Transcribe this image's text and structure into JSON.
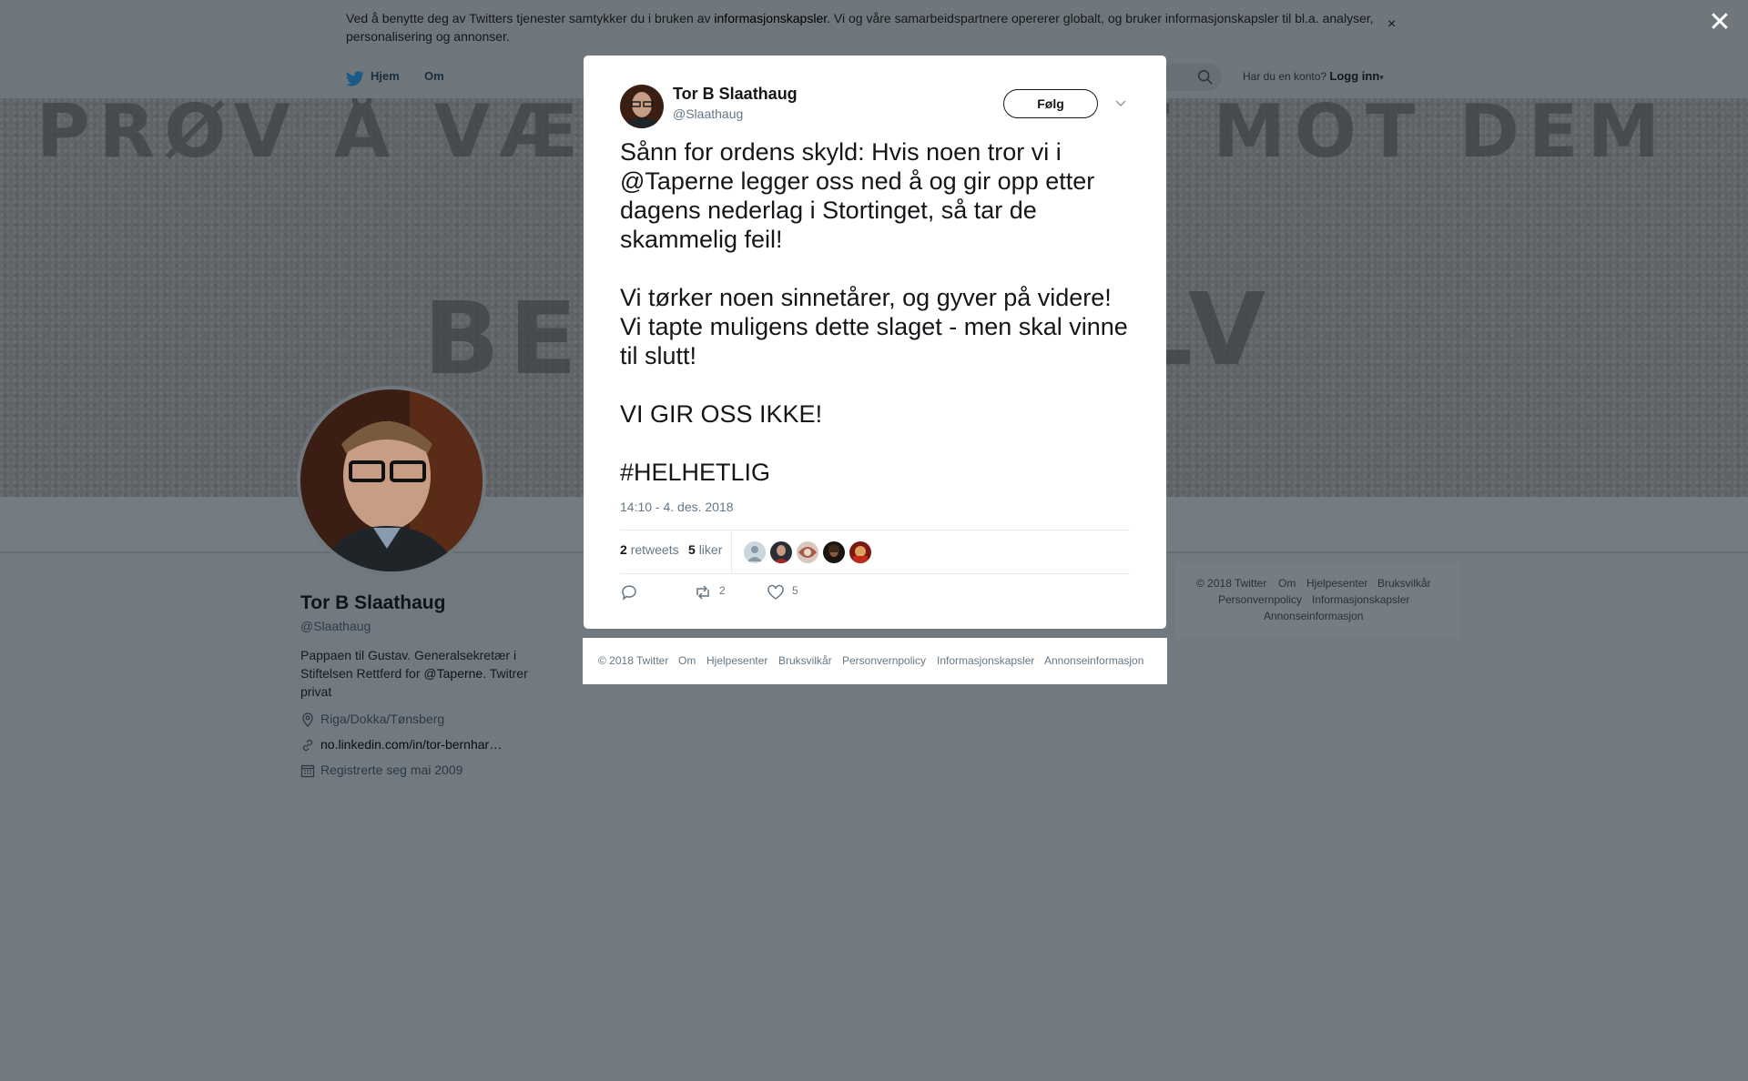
{
  "cookie": {
    "text_before": "Ved å benytte deg av Twitters tjenester samtykker du i bruken av ",
    "link": "informasjonskapsler",
    "text_after": ". Vi og våre samarbeidspartnere opererer globalt, og bruker informasjonskapsler til bl.a. analyser, personalisering og annonser.",
    "close": "×"
  },
  "overlay_close": "✕",
  "nav": {
    "home": "Hjem",
    "about": "Om",
    "login_prompt": "Har du en konto?",
    "login": "Logg inn"
  },
  "banner_words": [
    "PRØV Å VÆ",
    "T MOT DEM",
    "BES",
    "LV"
  ],
  "profile": {
    "name": "Tor B Slaathaug",
    "handle": "@Slaathaug",
    "bio_before": "Pappaen til Gustav. Generalsekretær i Stiftelsen Rettferd for ",
    "bio_mention": "@Taperne",
    "bio_after": ". Twitrer privat",
    "location": "Riga/Dokka/Tønsberg",
    "website": "no.linkedin.com/in/tor-bernhar…",
    "joined": "Registrerte seg mai 2009"
  },
  "side_footer": {
    "copyright": "© 2018 Twitter",
    "links": [
      "Om",
      "Hjelpesenter",
      "Bruksvilkår",
      "Personvernpolicy",
      "Informasjonskapsler",
      "Annonseinformasjon"
    ]
  },
  "tweet": {
    "author_name": "Tor B Slaathaug",
    "author_handle": "@Slaathaug",
    "follow_label": "Følg",
    "p1_before": "Sånn for ordens skyld: Hvis noen tror vi i ",
    "p1_mention": "@Taperne",
    "p1_after": " legger oss ned å og gir opp etter dagens nederlag i Stortinget, så tar de skammelig feil!",
    "p2": "Vi tørker noen sinnetårer, og gyver på videre! Vi tapte muligens dette slaget - men skal vinne til slutt!",
    "p3": "VI GIR OSS IKKE!",
    "p4": "#HELHETLIG",
    "timestamp": "14:10 - 4. des. 2018",
    "retweet_count": "2",
    "retweet_label": "retweets",
    "like_count": "5",
    "like_label": "liker",
    "action_retweets": "2",
    "action_likes": "5"
  },
  "modal_footer": {
    "copyright": "© 2018 Twitter",
    "links": [
      "Om",
      "Hjelpesenter",
      "Bruksvilkår",
      "Personvernpolicy",
      "Informasjonskapsler",
      "Annonseinformasjon"
    ]
  },
  "colors": {
    "overlay": "#717a80",
    "twitter_blue": "#1da1f2",
    "muted_text": "#657786"
  }
}
